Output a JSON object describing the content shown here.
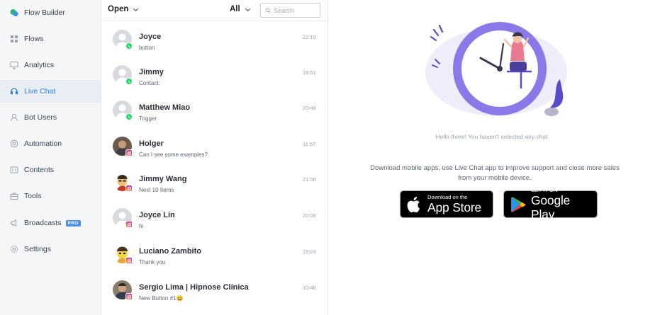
{
  "sidebar": {
    "items": [
      {
        "label": "Flow Builder",
        "icon": "chat-bubbles-icon"
      },
      {
        "label": "Flows",
        "icon": "grid-icon"
      },
      {
        "label": "Analytics",
        "icon": "monitor-icon"
      },
      {
        "label": "Live Chat",
        "icon": "headset-icon",
        "active": true
      },
      {
        "label": "Bot Users",
        "icon": "user-icon"
      },
      {
        "label": "Automation",
        "icon": "automation-icon"
      },
      {
        "label": "Contents",
        "icon": "contents-icon"
      },
      {
        "label": "Tools",
        "icon": "toolbox-icon"
      },
      {
        "label": "Broadcasts",
        "icon": "megaphone-icon",
        "badge": "PRO"
      },
      {
        "label": "Settings",
        "icon": "gear-icon"
      }
    ]
  },
  "list": {
    "status_filter": "Open",
    "scope_filter": "All",
    "search_placeholder": "Search",
    "chats": [
      {
        "name": "Joyce",
        "preview": "button",
        "time": "22:10",
        "channel": "whatsapp",
        "avatar": "placeholder"
      },
      {
        "name": "Jimmy",
        "preview": "Contact:",
        "time": "18:51",
        "channel": "whatsapp",
        "avatar": "placeholder"
      },
      {
        "name": "Matthew Miao",
        "preview": "Trigger",
        "time": "20:48",
        "channel": "whatsapp",
        "avatar": "placeholder"
      },
      {
        "name": "Holger",
        "preview": "Can I see some examples?",
        "time": "11:57",
        "channel": "instagram",
        "avatar": "photo"
      },
      {
        "name": "Jimmy Wang",
        "preview": "Next 10 Items",
        "time": "21:08",
        "channel": "instagram",
        "avatar": "cartoon"
      },
      {
        "name": "Joyce Lin",
        "preview": "hi",
        "time": "20:08",
        "channel": "instagram",
        "avatar": "placeholder"
      },
      {
        "name": "Luciano Zambito",
        "preview": "Thank you",
        "time": "19:24",
        "channel": "instagram",
        "avatar": "cartoon-yellow"
      },
      {
        "name": "Sergio Lima | Hipnose Clínica",
        "preview": "New Button #1😄",
        "time": "10:48",
        "channel": "instagram",
        "avatar": "photo"
      }
    ]
  },
  "pane": {
    "empty_message": "Hello there! You haven't selected any chat",
    "download_message": "Download mobile apps, use Live Chat app to improve support and close more sales from your mobile device.",
    "app_store": {
      "small": "Download on the",
      "big": "App Store"
    },
    "google_play": {
      "small": "GET IT ON",
      "big": "Google Play"
    }
  },
  "colors": {
    "accent": "#2f7fd9",
    "sidebar_bg": "#f4f6f8",
    "clock_ring": "#8a79e8",
    "whatsapp": "#25d366"
  }
}
